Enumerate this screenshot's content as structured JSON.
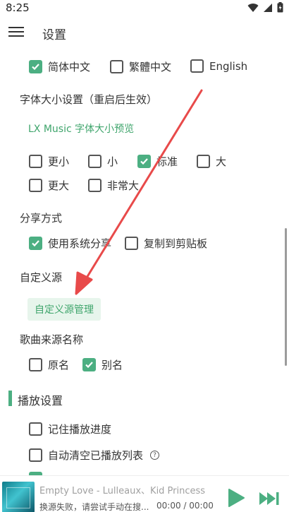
{
  "status": {
    "time": "8:25"
  },
  "header": {
    "title": "设置"
  },
  "language": {
    "options": [
      {
        "label": "简体中文",
        "checked": true
      },
      {
        "label": "繁體中文",
        "checked": false
      },
      {
        "label": "English",
        "checked": false
      }
    ]
  },
  "font_size": {
    "label": "字体大小设置（重启后生效）",
    "preview": "LX Music 字体大小预览",
    "options": [
      {
        "label": "更小",
        "checked": false
      },
      {
        "label": "小",
        "checked": false
      },
      {
        "label": "标准",
        "checked": true
      },
      {
        "label": "大",
        "checked": false
      },
      {
        "label": "更大",
        "checked": false
      },
      {
        "label": "非常大",
        "checked": false
      }
    ]
  },
  "share": {
    "label": "分享方式",
    "options": [
      {
        "label": "使用系统分享",
        "checked": true
      },
      {
        "label": "复制到剪贴板",
        "checked": false
      }
    ]
  },
  "custom_source": {
    "label": "自定义源",
    "button": "自定义源管理"
  },
  "source_name": {
    "label": "歌曲来源名称",
    "options": [
      {
        "label": "原名",
        "checked": false
      },
      {
        "label": "别名",
        "checked": true
      }
    ]
  },
  "playback": {
    "title": "播放设置",
    "options": [
      {
        "label": "记住播放进度",
        "checked": false
      },
      {
        "label": "自动清空已播放列表",
        "checked": false
      }
    ],
    "help_glyph": "?"
  },
  "player": {
    "song": "Empty Love - Lulleaux、Kid Princess",
    "status": "换源失败，请尝试手动在搜...",
    "time": "00:00 / 00:00"
  },
  "colors": {
    "accent": "#4caf82",
    "arrow": "#e84a4a"
  }
}
